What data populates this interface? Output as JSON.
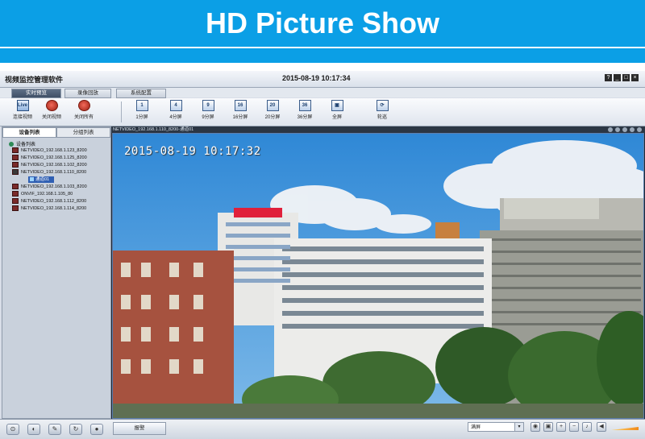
{
  "banner": {
    "title": "HD Picture Show"
  },
  "app": {
    "name": "视频监控管理软件",
    "datetime": "2015-08-19 10:17:34",
    "window_buttons": [
      "?",
      "_",
      "□",
      "×"
    ],
    "tabs": [
      {
        "label": "实时预览",
        "active": true
      },
      {
        "label": "录像回放",
        "active": false
      },
      {
        "label": "系统配置",
        "active": false
      }
    ],
    "toolbar": [
      {
        "label": "连接视频",
        "icon": "connect-video-icon",
        "glyph": "Live"
      },
      {
        "label": "关闭视频",
        "icon": "close-video-icon",
        "glyph": ""
      },
      {
        "label": "关闭所有",
        "icon": "close-all-icon",
        "glyph": ""
      },
      {
        "label": "1分屏",
        "icon": "split-1-icon",
        "glyph": "1"
      },
      {
        "label": "4分屏",
        "icon": "split-4-icon",
        "glyph": "4"
      },
      {
        "label": "9分屏",
        "icon": "split-9-icon",
        "glyph": "9"
      },
      {
        "label": "16分屏",
        "icon": "split-16-icon",
        "glyph": "16"
      },
      {
        "label": "20分屏",
        "icon": "split-20-icon",
        "glyph": "20"
      },
      {
        "label": "36分屏",
        "icon": "split-36-icon",
        "glyph": "36"
      },
      {
        "label": "全屏",
        "icon": "fullscreen-icon",
        "glyph": "▣"
      },
      {
        "label": "轮巡",
        "icon": "cruise-icon",
        "glyph": "⟳"
      }
    ],
    "left_tabs": [
      {
        "label": "设备列表",
        "active": true
      },
      {
        "label": "分组列表",
        "active": false
      }
    ],
    "tree": {
      "root": "设备列表",
      "devices": [
        "NETVIDEO_192.168.1.123_8200",
        "NETVIDEO_192.168.1.125_8200",
        "NETVIDEO_192.168.1.102_8200",
        "NETVIDEO_192.168.1.110_8200",
        "NETVIDEO_192.168.1.103_8200",
        "ONVIF_192.168.1.105_80",
        "NETVIDEO_192.168.1.112_8200",
        "NETVIDEO_192.168.1.114_8200"
      ],
      "open_channel": "通道01"
    },
    "video": {
      "caption": "NETVIDEO_192.168.1.110_8200-通道01",
      "osd_timestamp": "2015-08-19  10:17:32"
    },
    "bottom": {
      "alarm_label": "报警",
      "stretch_option": "满屏"
    }
  }
}
